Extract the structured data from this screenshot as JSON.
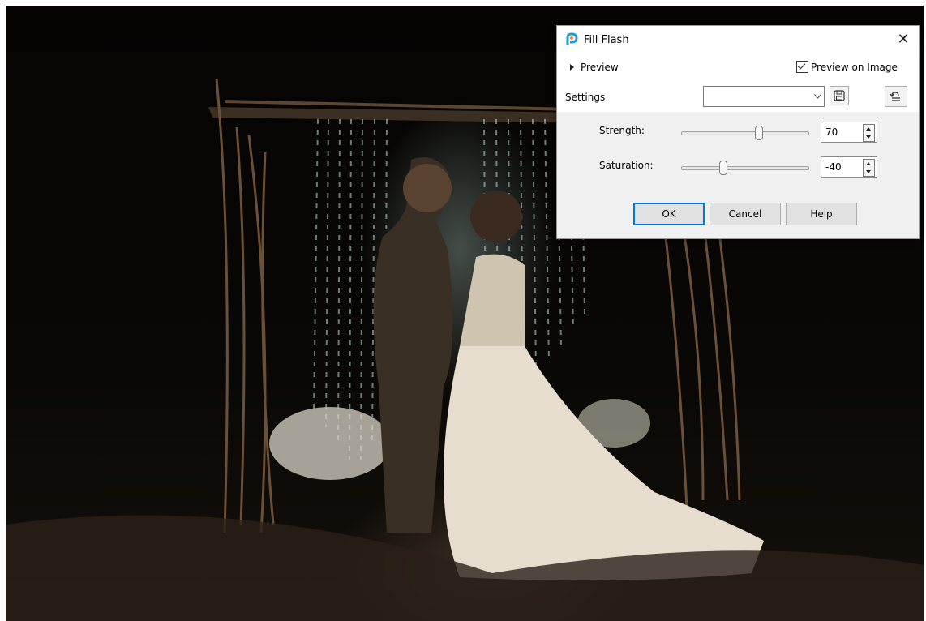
{
  "dialog": {
    "title": "Fill Flash",
    "close_icon": "close-icon",
    "preview_label": "Preview",
    "preview_on_image_label": "Preview on Image",
    "preview_on_image_checked": true,
    "settings_label": "Settings",
    "settings_value": "",
    "strength": {
      "label": "Strength:",
      "value": "70",
      "level": 0.62
    },
    "saturation": {
      "label": "Saturation:",
      "value": "-40",
      "level": 0.32
    },
    "buttons": {
      "ok": "OK",
      "cancel": "Cancel",
      "help": "Help"
    },
    "accent": "#0078d7"
  }
}
